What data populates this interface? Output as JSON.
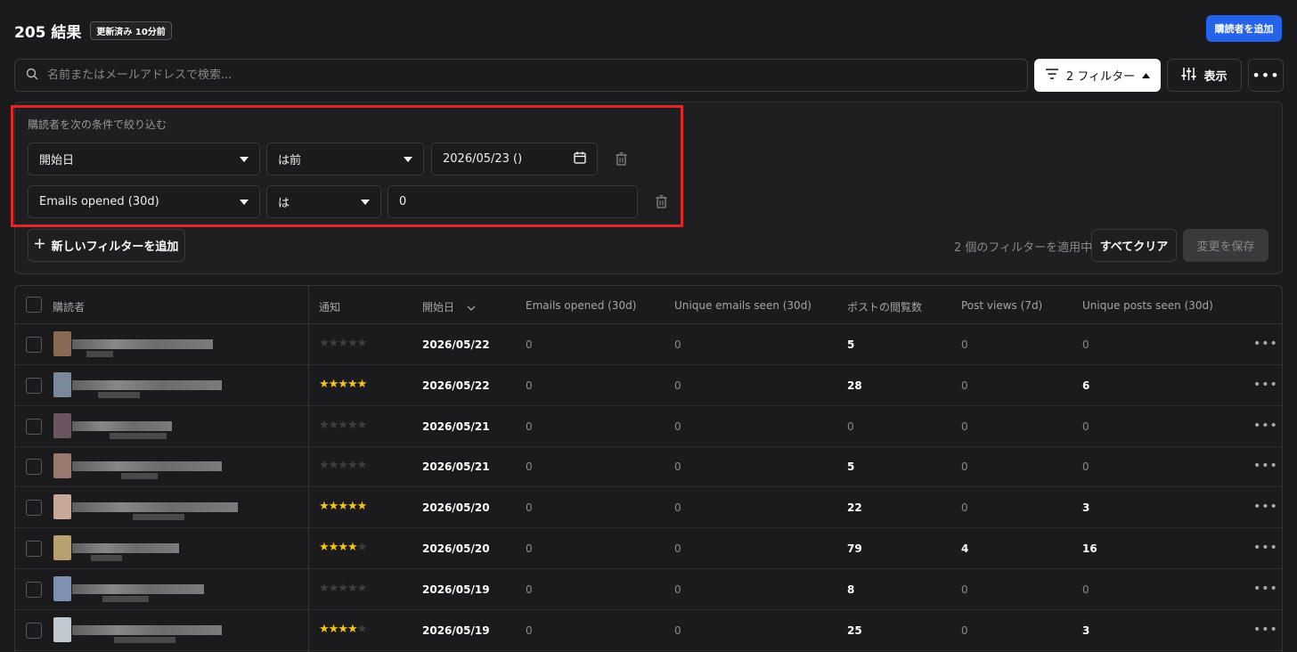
{
  "header": {
    "title": "205 結果",
    "updated_badge": "更新済み 10分前",
    "add_subscriber_button": "購読者を追加"
  },
  "search": {
    "placeholder": "名前またはメールアドレスで検索..."
  },
  "toolbar": {
    "filter_button": "2 フィルター",
    "view_button": "表示"
  },
  "filter_panel": {
    "heading": "購読者を次の条件で絞り込む",
    "filters": [
      {
        "field": "開始日",
        "operator": "は前",
        "value": "2026/05/23 ()"
      },
      {
        "field": "Emails opened (30d)",
        "operator": "は",
        "value": "0"
      }
    ],
    "add_filter_button": "新しいフィルターを追加",
    "applied_text": "2 個のフィルターを適用中",
    "clear_all_button": "すべてクリア",
    "save_button": "変更を保存"
  },
  "table": {
    "columns": [
      "購読者",
      "通知",
      "開始日",
      "Emails opened (30d)",
      "Unique emails seen (30d)",
      "ポストの閲覧数",
      "Post views (7d)",
      "Unique posts seen (30d)"
    ],
    "rows": [
      {
        "stars": 0,
        "start": "2026/05/22",
        "emails_opened": "0",
        "unique_emails": "0",
        "post_views": "5",
        "post_views_7d": "0",
        "unique_posts": "0"
      },
      {
        "stars": 5,
        "start": "2026/05/22",
        "emails_opened": "0",
        "unique_emails": "0",
        "post_views": "28",
        "post_views_7d": "0",
        "unique_posts": "6"
      },
      {
        "stars": 0,
        "start": "2026/05/21",
        "emails_opened": "0",
        "unique_emails": "0",
        "post_views": "0",
        "post_views_7d": "0",
        "unique_posts": "0"
      },
      {
        "stars": 0,
        "start": "2026/05/21",
        "emails_opened": "0",
        "unique_emails": "0",
        "post_views": "5",
        "post_views_7d": "0",
        "unique_posts": "0"
      },
      {
        "stars": 5,
        "start": "2026/05/20",
        "emails_opened": "0",
        "unique_emails": "0",
        "post_views": "22",
        "post_views_7d": "0",
        "unique_posts": "3"
      },
      {
        "stars": 4,
        "start": "2026/05/20",
        "emails_opened": "0",
        "unique_emails": "0",
        "post_views": "79",
        "post_views_7d": "4",
        "unique_posts": "16"
      },
      {
        "stars": 0,
        "start": "2026/05/19",
        "emails_opened": "0",
        "unique_emails": "0",
        "post_views": "8",
        "post_views_7d": "0",
        "unique_posts": "0"
      },
      {
        "stars": 4,
        "start": "2026/05/19",
        "emails_opened": "0",
        "unique_emails": "0",
        "post_views": "25",
        "post_views_7d": "0",
        "unique_posts": "3"
      }
    ]
  },
  "colors": {
    "accent": "#2563eb",
    "highlight": "#e0262b",
    "star": "#f5c518"
  }
}
